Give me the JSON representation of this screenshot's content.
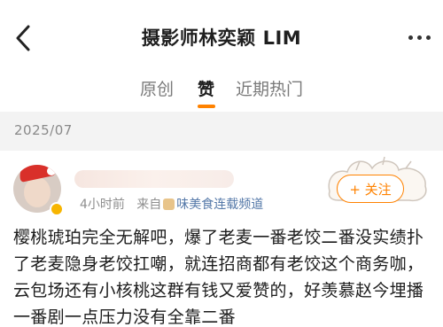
{
  "header": {
    "title": "摄影师林奕颖 LIM"
  },
  "tabs": [
    {
      "label": "原创"
    },
    {
      "label": "赞"
    },
    {
      "label": "近期热门"
    }
  ],
  "active_tab": "赞",
  "date_group": "2025/07",
  "post": {
    "time": "4小时前",
    "from_label": "来自",
    "source": "味美食连载频道",
    "follow_label": "+ 关注",
    "text": "樱桃琥珀完全无解吧，爆了老麦一番老饺二番没实绩扑了老麦隐身老饺扛嘲，就连招商都有老饺这个商务咖，云包场还有小核桃这群有钱又爱赞的，好羡慕赵今埋播一番剧一点压力没有全靠二番"
  },
  "colors": {
    "accent": "#ff8200",
    "source_link": "#5478a8",
    "date_bar_bg": "#f3f3f3"
  },
  "icons": [
    "back-arrow-icon",
    "more-dots-icon",
    "verified-badge-icon",
    "source-icon"
  ]
}
